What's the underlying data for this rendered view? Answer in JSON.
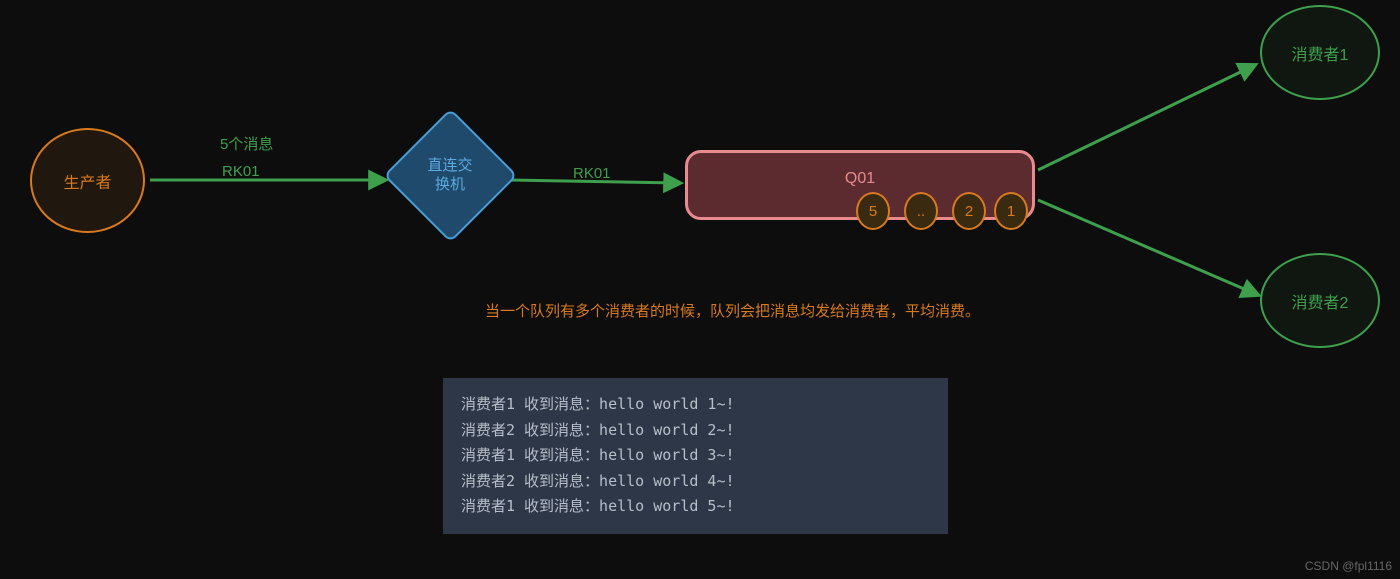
{
  "producer": {
    "label": "生产者"
  },
  "exchange": {
    "label_line1": "直连交",
    "label_line2": "换机"
  },
  "queue": {
    "label": "Q01"
  },
  "messages": {
    "label_above": "5个消息",
    "routing_key_1": "RK01",
    "routing_key_2": "RK01",
    "bubbles": [
      "5",
      "..",
      "2",
      "1"
    ]
  },
  "consumers": {
    "c1": "消费者1",
    "c2": "消费者2"
  },
  "note": "当一个队列有多个消费者的时候，队列会把消息均发给消费者，平均消费。",
  "console_lines": [
    "消费者1 收到消息：hello world  1~!",
    "消费者2 收到消息：hello world  2~!",
    "消费者1 收到消息：hello world  3~!",
    "消费者2 收到消息：hello world  4~!",
    "消费者1 收到消息：hello world  5~!"
  ],
  "watermark": "CSDN @fpl1116",
  "colors": {
    "bg": "#0d0d0d",
    "orange": "#d87a1d",
    "green": "#3ea04c",
    "blue": "#4a9ed8",
    "pink": "#e88a8e"
  }
}
